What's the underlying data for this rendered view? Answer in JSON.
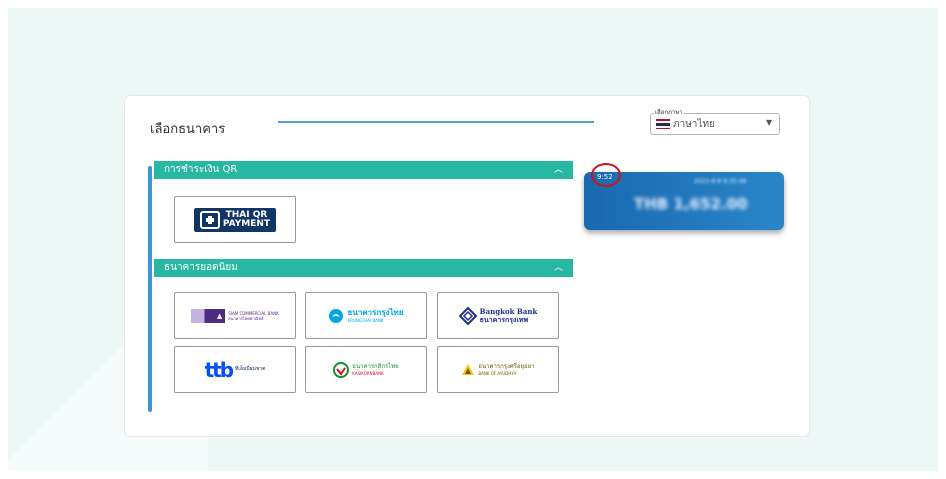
{
  "page": {
    "title": "เลือกธนาคาร"
  },
  "language": {
    "legend": "เลือกภาษา",
    "selected": "ภาษาไทย",
    "flag_colors": [
      "#a51931",
      "#f4f5f8",
      "#2d2a4a",
      "#f4f5f8",
      "#a51931"
    ]
  },
  "sections": {
    "qr": {
      "label": "การชำระเงิน QR",
      "items": [
        {
          "name": "THAI QR",
          "sub": "PAYMENT",
          "color": "#113566"
        }
      ]
    },
    "popular": {
      "label": "ธนาคารยอดนิยม",
      "items": [
        {
          "name": "SIAM COMMERCIAL BANK",
          "sub": "ธนาคารไทยพาณิชย์",
          "color": "#4e2a84"
        },
        {
          "name": "ธนาคารกรุงไทย",
          "sub": "KRUNGTHAI BANK",
          "color": "#00a5e3"
        },
        {
          "name": "Bangkok Bank",
          "sub": "ธนาคารกรุงเทพ",
          "color": "#1f2f8c"
        },
        {
          "name": "ttb",
          "sub": "ทีเอ็มบีธนชาต",
          "color": "#0050f0"
        },
        {
          "name": "ธนาคารกสิกรไทย",
          "sub": "KASIKORNBANK",
          "color": "#138f2d"
        },
        {
          "name": "ธนาคารกรุงศรีอยุธยา",
          "sub": "BANK OF AYUDHYA",
          "color": "#6b5a00"
        }
      ]
    }
  },
  "payment": {
    "timer": "9:52",
    "date": "2021-8-8 9:35:48",
    "amount": "THB 1,652.00"
  },
  "colors": {
    "accent": "#28b7a3",
    "blue_line": "#4aa3d6",
    "card_blue": "#1868b0",
    "timer_ring": "#d0121b"
  }
}
